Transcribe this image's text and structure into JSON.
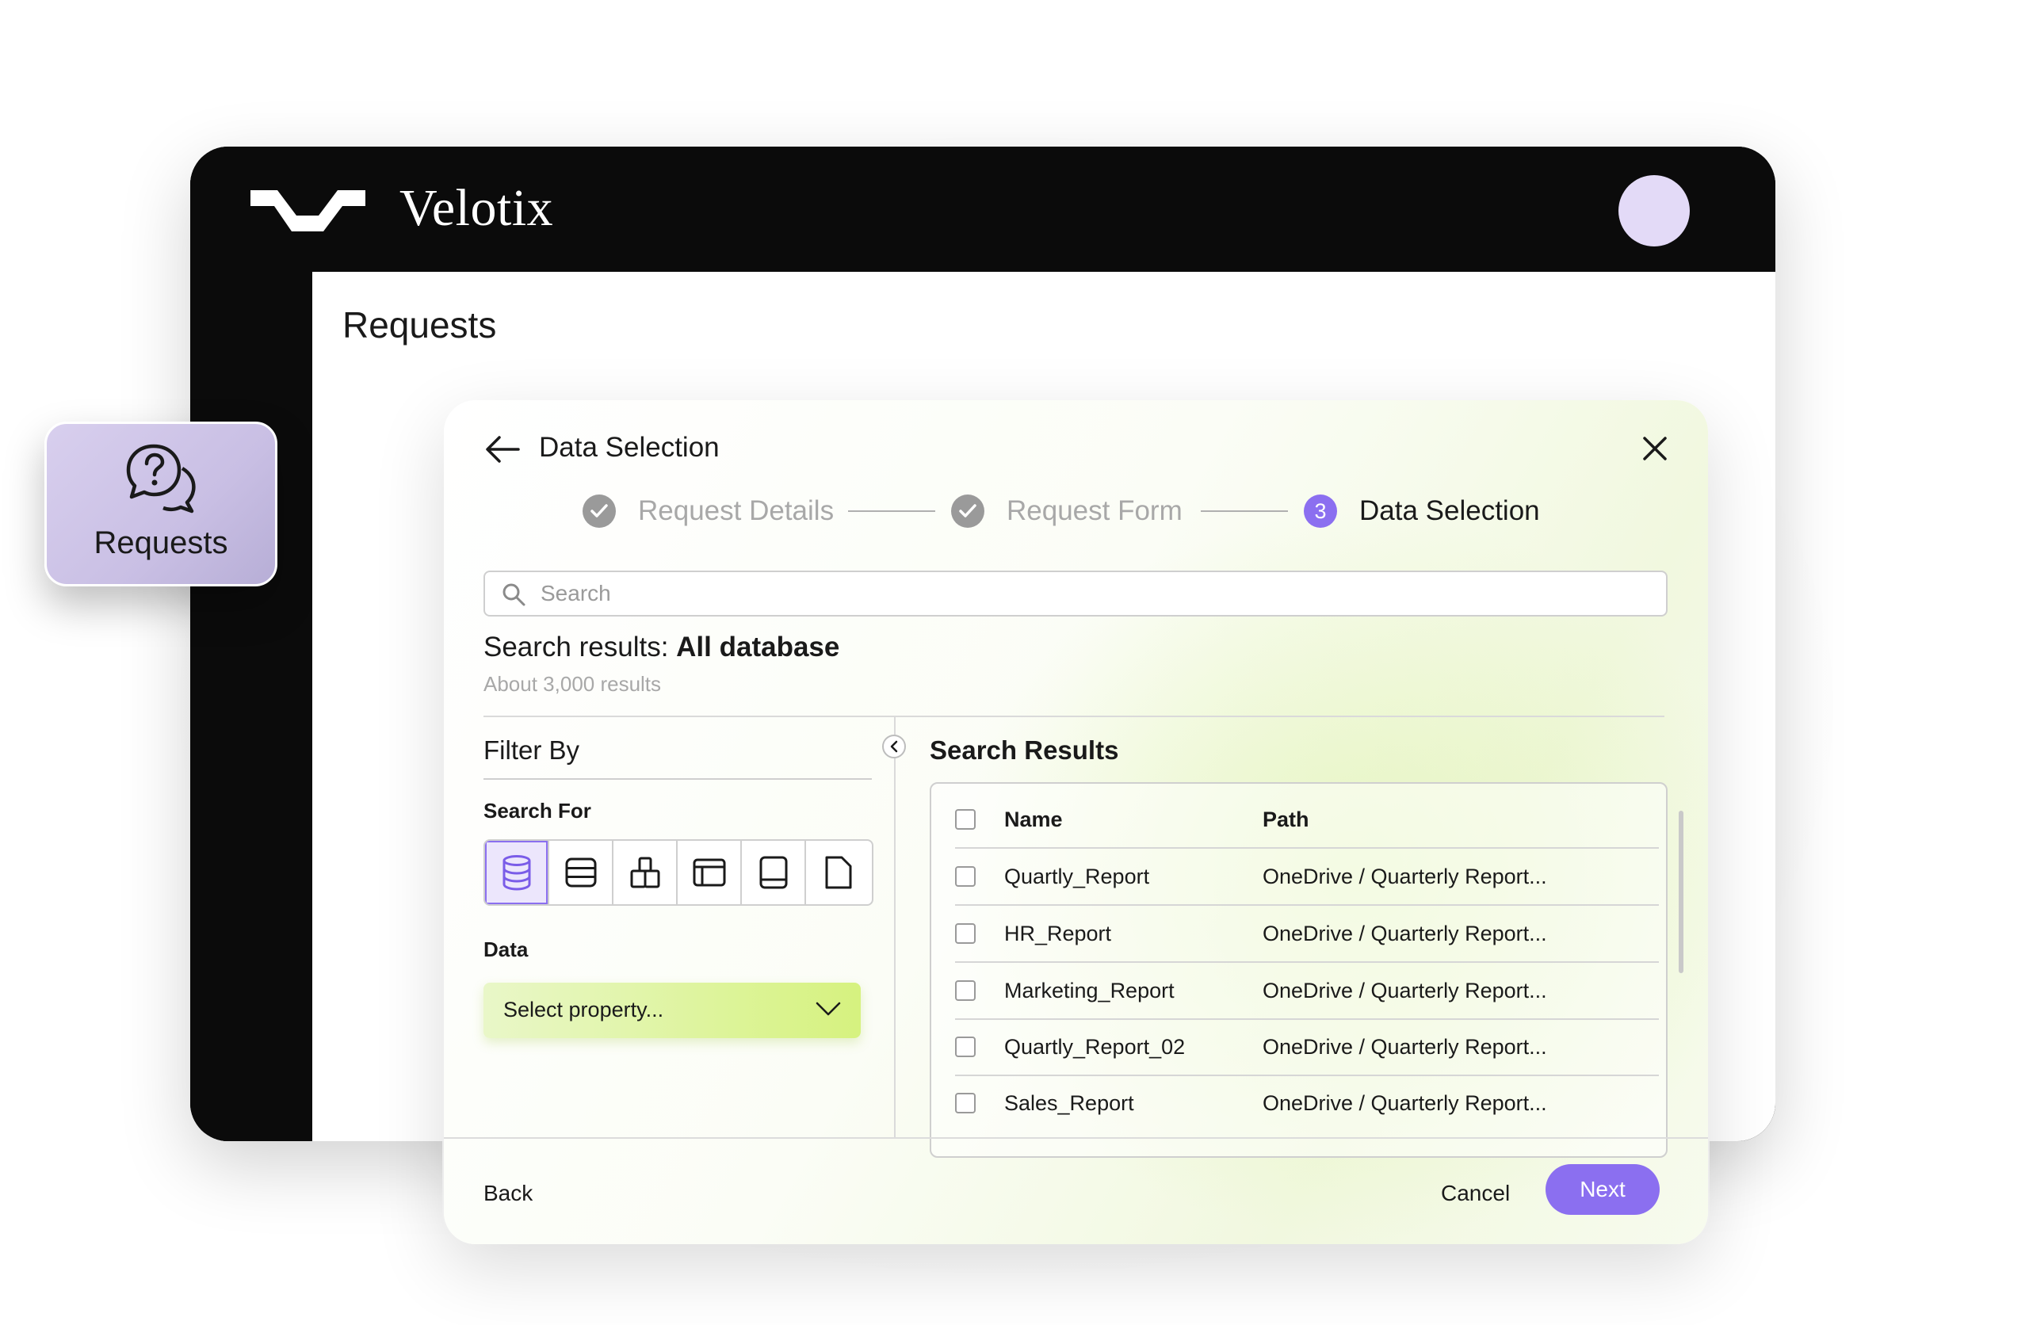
{
  "app": {
    "brand": "Velotix"
  },
  "page": {
    "title": "Requests"
  },
  "floating_card": {
    "label": "Requests",
    "icon": "question-chat-icon"
  },
  "modal": {
    "title": "Data Selection",
    "steps": [
      {
        "label": "Request Details",
        "state": "done"
      },
      {
        "label": "Request Form",
        "state": "done"
      },
      {
        "label": "Data Selection",
        "state": "active",
        "number": "3"
      }
    ],
    "search": {
      "placeholder": "Search"
    },
    "results": {
      "prefix": "Search results: ",
      "scope": "All database",
      "count": "About 3,000 results"
    },
    "filter": {
      "title": "Filter By",
      "search_for_label": "Search For",
      "search_for_icons": [
        "database-icon",
        "table-icon",
        "schema-icon",
        "window-icon",
        "tablet-icon",
        "file-icon"
      ],
      "data_label": "Data",
      "select_placeholder": "Select property..."
    },
    "table": {
      "title": "Search Results",
      "columns": [
        "Name",
        "Path"
      ],
      "rows": [
        {
          "name": "Quartly_Report",
          "path": "OneDrive / Quarterly Report..."
        },
        {
          "name": "HR_Report",
          "path": "OneDrive / Quarterly Report..."
        },
        {
          "name": "Marketing_Report",
          "path": "OneDrive / Quarterly Report..."
        },
        {
          "name": "Quartly_Report_02",
          "path": "OneDrive / Quarterly Report..."
        },
        {
          "name": "Sales_Report",
          "path": "OneDrive / Quarterly Report..."
        }
      ]
    },
    "footer": {
      "back": "Back",
      "cancel": "Cancel",
      "next": "Next"
    }
  },
  "colors": {
    "accent": "#8b6ff0",
    "lime": "#d6f27f",
    "frame": "#0b0b0b",
    "avatar": "#e3daf7"
  }
}
